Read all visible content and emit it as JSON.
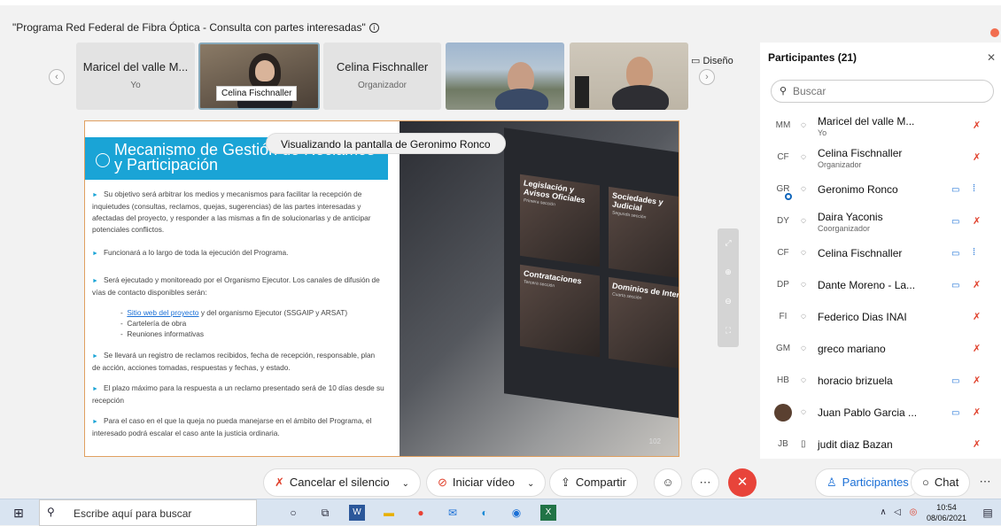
{
  "window": {
    "title": "\"Programa Red Federal de Fibra Óptica - Consulta con partes interesadas\""
  },
  "gallery": {
    "tiles": [
      {
        "name": "Maricel del valle M...",
        "role": "Yo"
      },
      {
        "label": "Celina Fischnaller"
      },
      {
        "name": "Celina Fischnaller",
        "role": "Organizador"
      }
    ],
    "layout_label": "Diseño"
  },
  "share": {
    "viewing_label": "Visualizando la pantalla de Geronimo Ronco",
    "slide_title": "Mecanismo de Gestión de Reclamos y Participación",
    "paragraphs": [
      "Su objetivo será arbitrar los medios y mecanismos para facilitar la recepción de inquietudes (consultas, reclamos, quejas, sugerencias) de las partes interesadas y afectadas del proyecto, y responder a las mismas a fin de solucionarlas y de anticipar potenciales conflictos.",
      "Funcionará a lo largo de toda la ejecución del Programa.",
      "Será ejecutado y monitoreado por el Organismo Ejecutor. Los canales de difusión de vías de contacto disponibles serán:"
    ],
    "channels": {
      "link": "Sitio web del proyecto",
      "link_rest": " y del organismo Ejecutor (SSGAIP y ARSAT)",
      "item2": "Cartelería de obra",
      "item3": "Reuniones informativas"
    },
    "paragraphs2": [
      "Se llevará un registro de reclamos recibidos, fecha de recepción, responsable, plan de acción, acciones tomadas, respuestas y fechas, y estado.",
      "El plazo máximo para la respuesta a un reclamo presentado será de 10 días desde su recepción",
      "Para el caso en el que la queja no pueda manejarse en el ámbito del Programa, el interesado podrá escalar el caso ante la justicia ordinaria."
    ],
    "cards": [
      {
        "title": "Legislación y Avisos Oficiales",
        "sub": "Primera sección"
      },
      {
        "title": "Sociedades y Judicial",
        "sub": "Segunda sección"
      },
      {
        "title": "Contrataciones",
        "sub": "Tercera sección"
      },
      {
        "title": "Dominios de Inter",
        "sub": "Cuarta sección"
      }
    ],
    "page_number": "102"
  },
  "participants": {
    "title": "Participantes (21)",
    "search_placeholder": "Buscar",
    "list": [
      {
        "initials": "MM",
        "name": "Maricel del valle M...",
        "role": "Yo",
        "video": false,
        "muted": true
      },
      {
        "initials": "CF",
        "name": "Celina Fischnaller",
        "role": "Organizador",
        "video": false,
        "muted": true
      },
      {
        "initials": "GR",
        "name": "Geronimo Ronco",
        "role": "",
        "video": true,
        "muted": false
      },
      {
        "initials": "DY",
        "name": "Daira Yaconis",
        "role": "Coorganizador",
        "video": true,
        "muted": true
      },
      {
        "initials": "CF",
        "name": "Celina Fischnaller",
        "role": "",
        "video": true,
        "muted": false
      },
      {
        "initials": "DP",
        "name": "Dante Moreno - La...",
        "role": "",
        "video": true,
        "muted": true
      },
      {
        "initials": "FI",
        "name": "Federico Dias INAI",
        "role": "",
        "video": false,
        "muted": true
      },
      {
        "initials": "GM",
        "name": "greco mariano",
        "role": "",
        "video": false,
        "muted": true
      },
      {
        "initials": "HB",
        "name": "horacio brizuela",
        "role": "",
        "video": true,
        "muted": true
      },
      {
        "initials": "",
        "name": "Juan Pablo Garcia ...",
        "role": "",
        "video": true,
        "muted": true
      },
      {
        "initials": "JB",
        "name": "judit diaz Bazan",
        "role": "",
        "video": false,
        "muted": true
      }
    ]
  },
  "toolbar": {
    "unmute": "Cancelar el silencio",
    "video": "Iniciar vídeo",
    "share": "Compartir",
    "participants": "Participantes",
    "chat": "Chat"
  },
  "taskbar": {
    "search": "Escribe aquí para buscar",
    "time": "10:54",
    "date": "08/06/2021"
  }
}
